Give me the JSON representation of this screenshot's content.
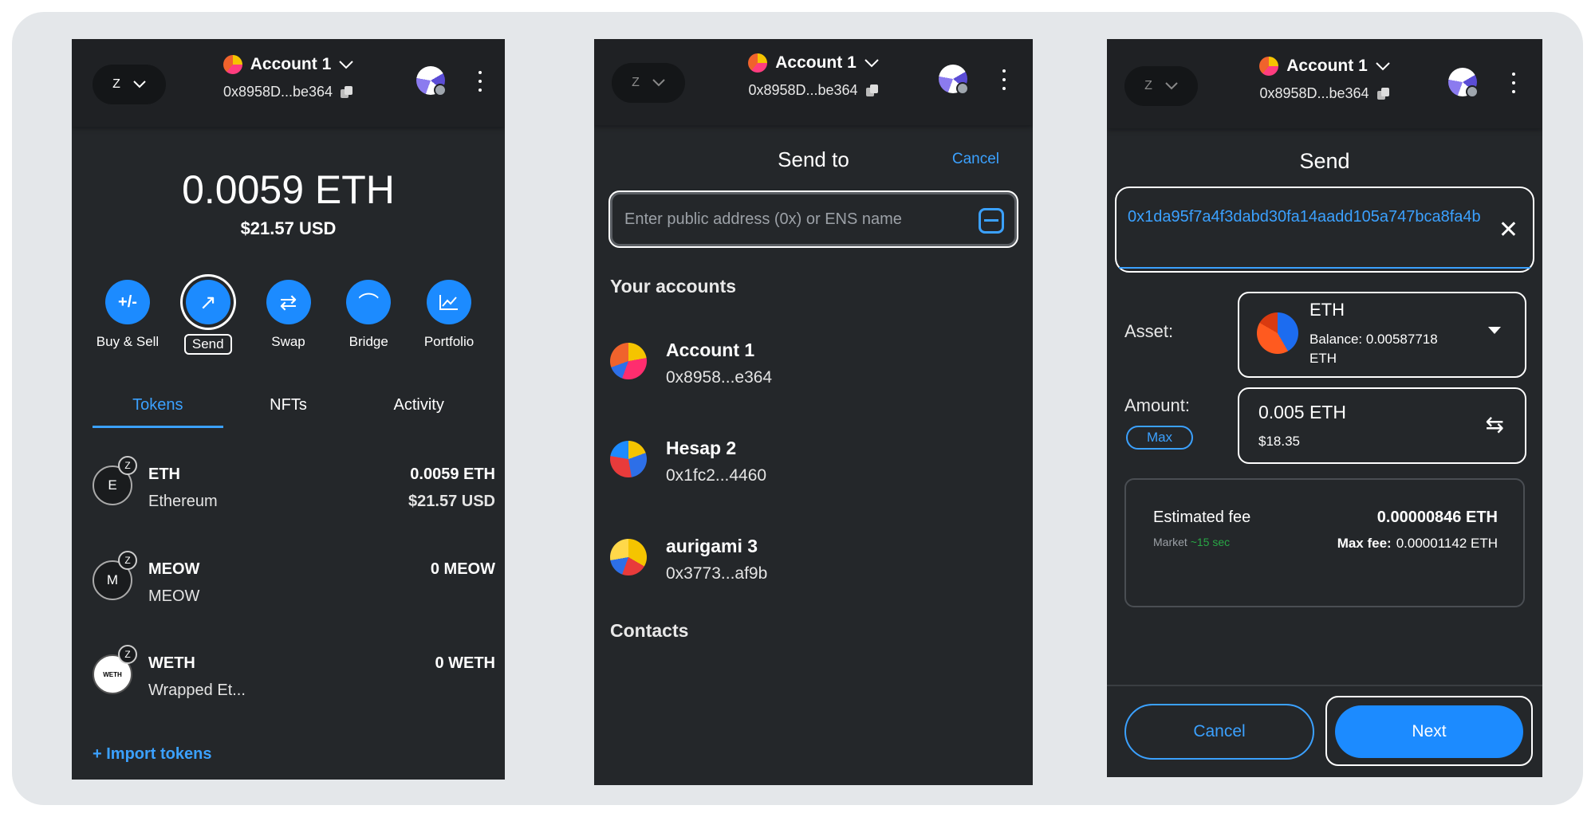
{
  "header": {
    "network_letter": "Z",
    "account_name": "Account 1",
    "address_short": "0x8958D...be364"
  },
  "wallet": {
    "balance": "0.0059 ETH",
    "fiat": "$21.57 USD",
    "actions": [
      {
        "label": "Buy & Sell",
        "icon": "buy-sell-icon",
        "glyph": "+/-"
      },
      {
        "label": "Send",
        "icon": "send-arrow-icon",
        "glyph": "↗"
      },
      {
        "label": "Swap",
        "icon": "swap-icon",
        "glyph": "⇄"
      },
      {
        "label": "Bridge",
        "icon": "bridge-icon",
        "glyph": "⌒"
      },
      {
        "label": "Portfolio",
        "icon": "chart-icon",
        "glyph": "📈"
      }
    ],
    "tabs": [
      "Tokens",
      "NFTs",
      "Activity"
    ],
    "tokens": [
      {
        "letter": "E",
        "symbol": "ETH",
        "name": "Ethereum",
        "amount": "0.0059 ETH",
        "fiat": "$21.57 USD"
      },
      {
        "letter": "M",
        "symbol": "MEOW",
        "name": "MEOW",
        "amount": "0 MEOW",
        "fiat": ""
      },
      {
        "letter": "WETH",
        "symbol": "WETH",
        "name": "Wrapped Et...",
        "amount": "0 WETH",
        "fiat": ""
      }
    ],
    "import_tokens": "+ Import tokens"
  },
  "send_to": {
    "title": "Send to",
    "cancel": "Cancel",
    "placeholder": "Enter public address (0x) or ENS name",
    "your_accounts": "Your accounts",
    "accounts": [
      {
        "name": "Account 1",
        "address": "0x8958...e364"
      },
      {
        "name": "Hesap 2",
        "address": "0x1fc2...4460"
      },
      {
        "name": "aurigami 3",
        "address": "0x3773...af9b"
      }
    ],
    "contacts": "Contacts"
  },
  "send": {
    "title": "Send",
    "recipient": "0x1da95f7a4f3dabd30fa14aadd105a747bca8fa4b",
    "asset_label": "Asset:",
    "asset_symbol": "ETH",
    "asset_balance": "Balance:  0.00587718 ETH",
    "amount_label": "Amount:",
    "amount_value": "0.005  ETH",
    "amount_fiat": "$18.35",
    "max": "Max",
    "fee_label": "Estimated fee",
    "fee_market": "Market",
    "fee_time": "~15 sec",
    "fee_value": "0.00000846 ETH",
    "max_fee_label": "Max fee:",
    "max_fee_value": "0.00001142 ETH",
    "cancel": "Cancel",
    "next": "Next"
  },
  "colors": {
    "accent": "#1c8bff",
    "panel": "#24272a",
    "header": "#1f2124"
  }
}
